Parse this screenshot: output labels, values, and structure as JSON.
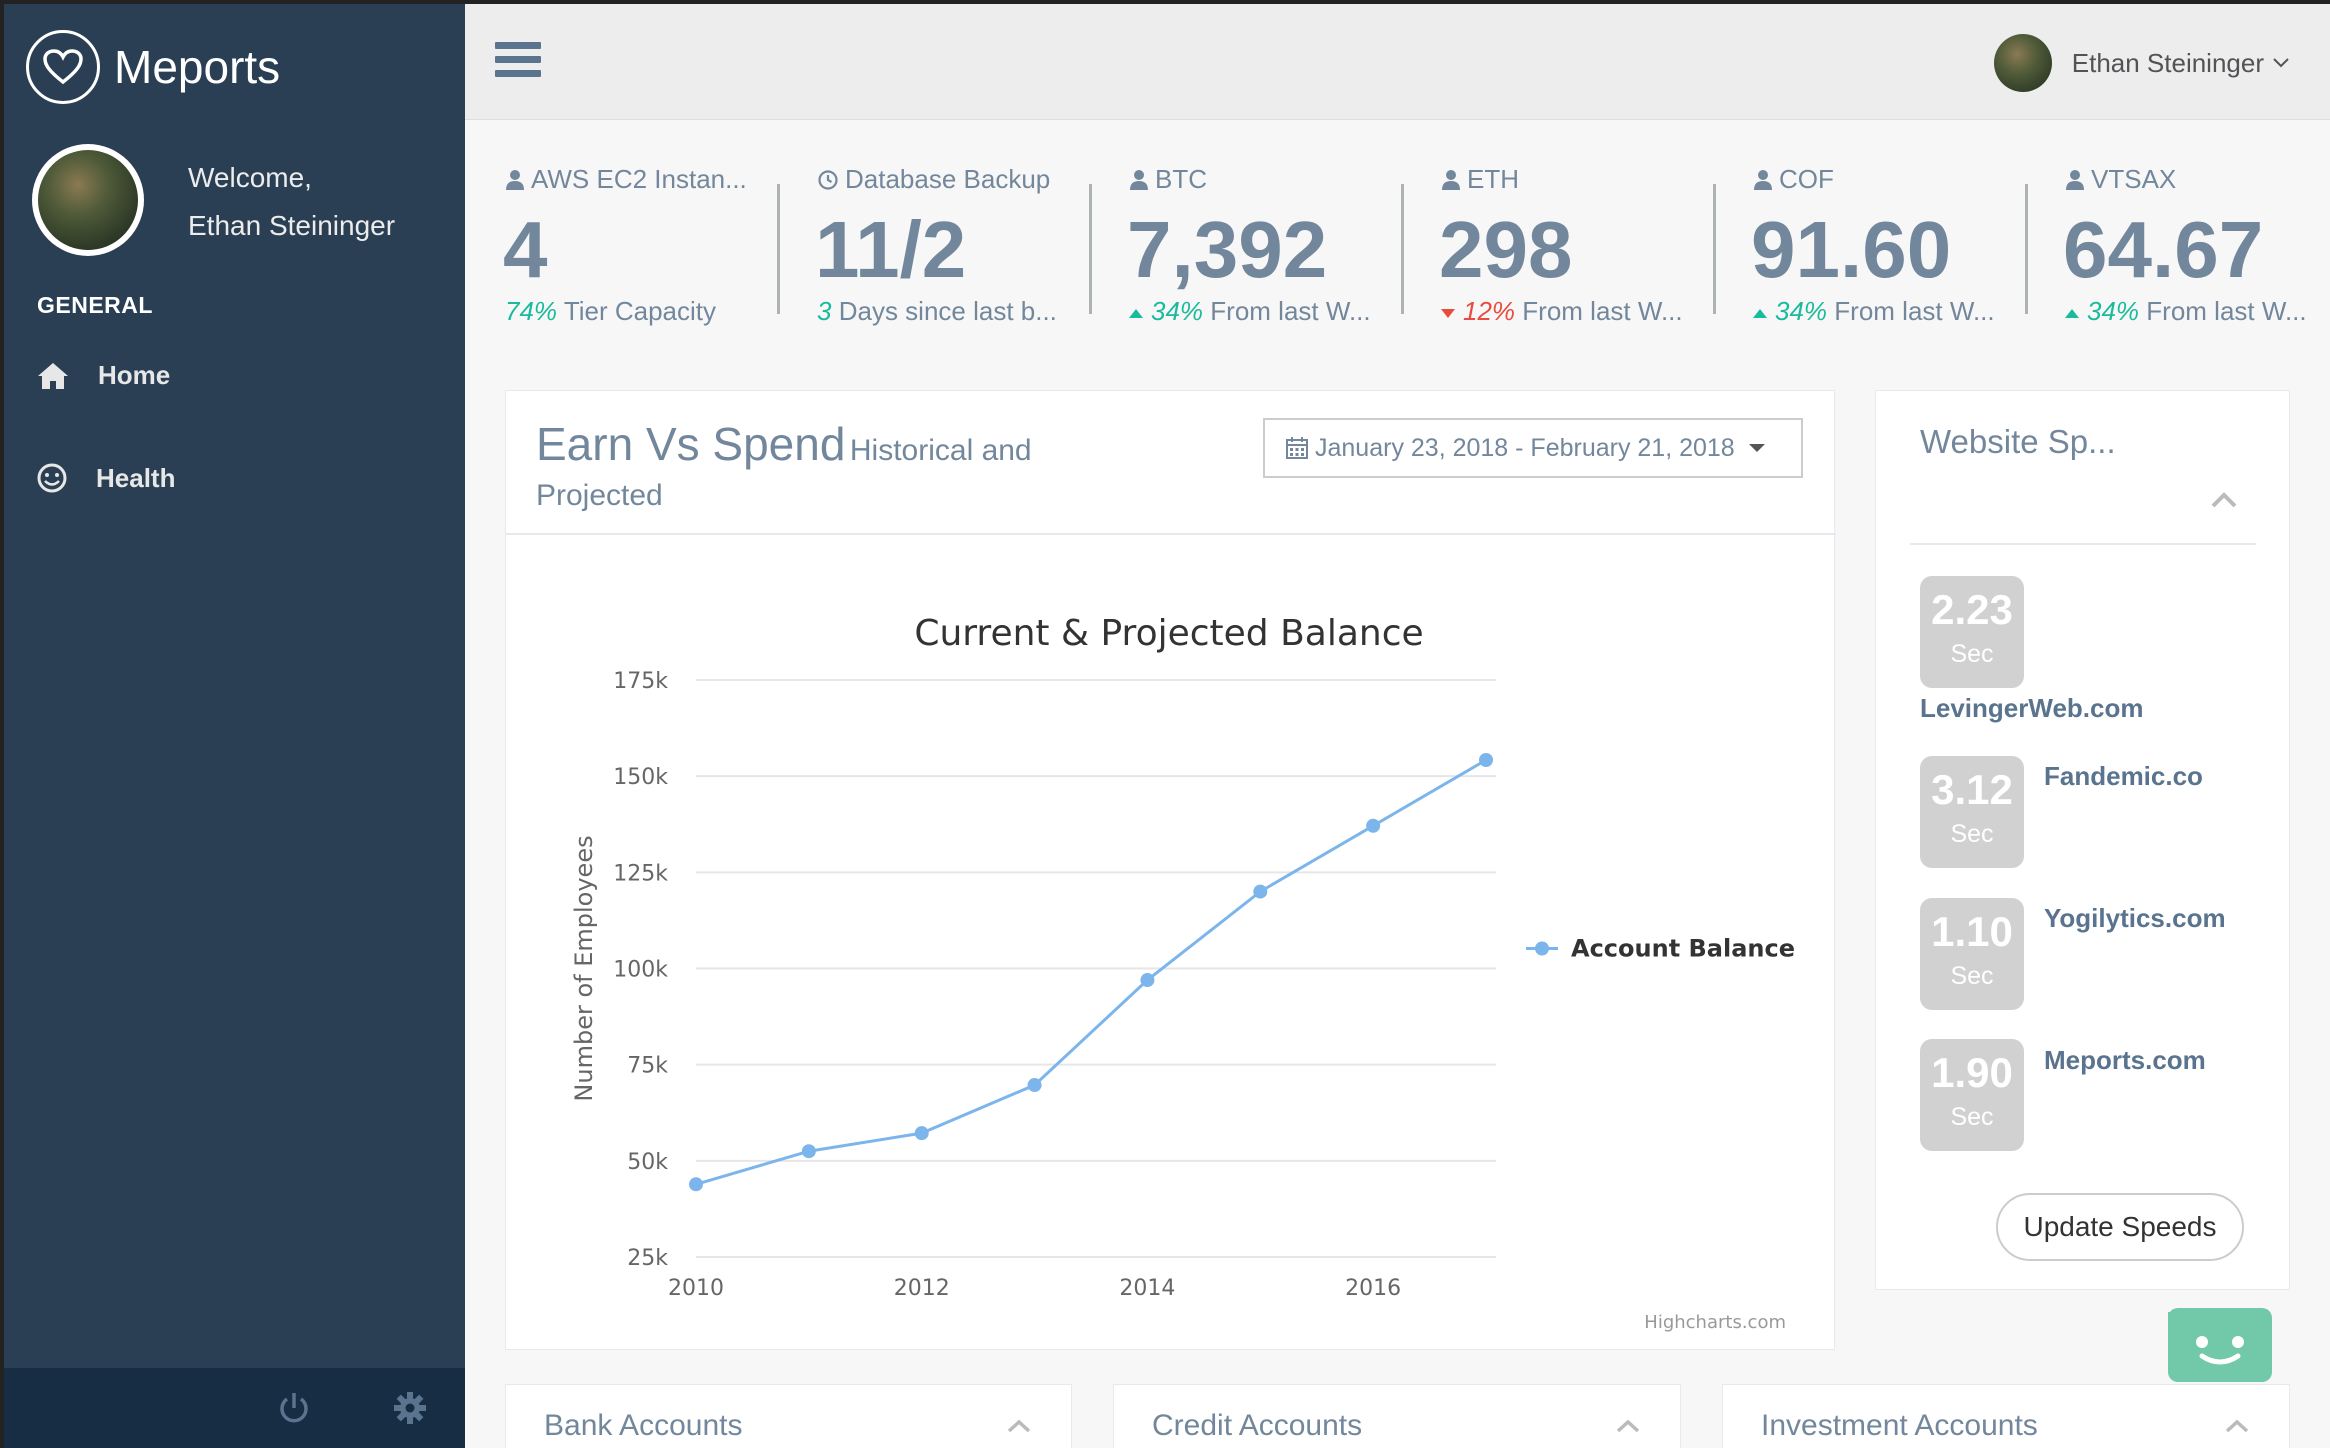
{
  "brand": {
    "name": "Meports",
    "icon": "heart-icon"
  },
  "user": {
    "welcome": "Welcome,",
    "name": "Ethan Steininger"
  },
  "sidebar": {
    "section_title": "GENERAL",
    "items": [
      {
        "label": "Home",
        "icon": "home-icon"
      },
      {
        "label": "Health",
        "icon": "smile-icon"
      }
    ],
    "footer_icons": [
      "power-icon",
      "gear-icon"
    ]
  },
  "topnav": {
    "user_name": "Ethan Steininger",
    "menu_icon": "hamburger-icon"
  },
  "tiles": [
    {
      "icon": "user-icon",
      "title": "AWS EC2 Instan...",
      "value": "4",
      "delta": "74%",
      "delta_dir": "none",
      "delta_color": "green",
      "suffix": "Tier Capacity"
    },
    {
      "icon": "clock-icon",
      "title": "Database Backup",
      "value": "11/2",
      "delta": "3",
      "delta_dir": "none",
      "delta_color": "green",
      "suffix": "Days since last b..."
    },
    {
      "icon": "user-icon",
      "title": "BTC",
      "value": "7,392",
      "delta": "34%",
      "delta_dir": "up",
      "delta_color": "green",
      "suffix": "From last W..."
    },
    {
      "icon": "user-icon",
      "title": "ETH",
      "value": "298",
      "delta": "12%",
      "delta_dir": "down",
      "delta_color": "red",
      "suffix": "From last W..."
    },
    {
      "icon": "user-icon",
      "title": "COF",
      "value": "91.60",
      "delta": "34%",
      "delta_dir": "up",
      "delta_color": "green",
      "suffix": "From last W..."
    },
    {
      "icon": "user-icon",
      "title": "VTSAX",
      "value": "64.67",
      "delta": "34%",
      "delta_dir": "up",
      "delta_color": "green",
      "suffix": "From last W..."
    }
  ],
  "earn_panel": {
    "title": "Earn Vs Spend",
    "subtitle_a": "Historical and",
    "subtitle_b": "Projected",
    "date_range": "January 23, 2018 - February 21, 2018",
    "date_icon": "calendar-icon"
  },
  "chart_data": {
    "type": "line",
    "title": "Current & Projected Balance",
    "ylabel": "Number of Employees",
    "xlabel": "",
    "x": [
      2010,
      2011,
      2012,
      2013,
      2014,
      2015,
      2016,
      2017
    ],
    "x_ticks": [
      "2010",
      "2012",
      "2014",
      "2016"
    ],
    "y_ticks": [
      "175k",
      "150k",
      "125k",
      "100k",
      "75k",
      "50k",
      "25k"
    ],
    "ylim": [
      25000,
      175000
    ],
    "xlim": [
      2010,
      2017
    ],
    "series": [
      {
        "name": "Account Balance",
        "values": [
          43900,
          52500,
          57200,
          69700,
          97000,
          120000,
          137100,
          154200
        ]
      }
    ],
    "legend_position": "right",
    "grid": true,
    "credit": "Highcharts.com",
    "color": "#7cb5ec"
  },
  "speed_panel": {
    "title": "Website Sp...",
    "sites": [
      {
        "value": "2.23",
        "unit": "Sec",
        "name": "LevingerWeb.com"
      },
      {
        "value": "3.12",
        "unit": "Sec",
        "name": "Fandemic.co"
      },
      {
        "value": "1.10",
        "unit": "Sec",
        "name": "Yogilytics.com"
      },
      {
        "value": "1.90",
        "unit": "Sec",
        "name": "Meports.com"
      }
    ],
    "button": "Update Speeds"
  },
  "bottom_panels": [
    {
      "title": "Bank Accounts"
    },
    {
      "title": "Credit Accounts"
    },
    {
      "title": "Investment Accounts"
    }
  ],
  "colors": {
    "sidebar": "#2a3f54",
    "green": "#1abb9c",
    "red": "#e74c3c",
    "chat": "#72c9a9"
  }
}
